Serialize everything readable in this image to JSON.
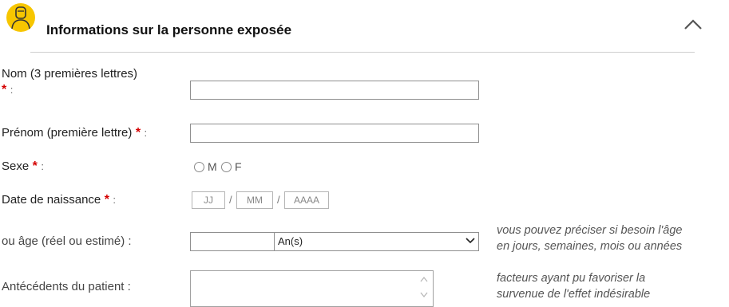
{
  "section": {
    "title": "Informations sur la personne exposée",
    "icon": "person-badge-icon",
    "accent_color": "#f7c600",
    "collapse_icon": "chevron-up-icon"
  },
  "fields": {
    "nom": {
      "label": "Nom (3 premières lettres)",
      "required_mark": "*",
      "colon": ":",
      "value": ""
    },
    "prenom": {
      "label": "Prénom (première lettre)",
      "required_mark": "*",
      "colon": ":",
      "value": ""
    },
    "sexe": {
      "label": "Sexe",
      "required_mark": "*",
      "colon": ":",
      "option_m": "M",
      "option_f": "F"
    },
    "date_naissance": {
      "label": "Date de naissance",
      "required_mark": "*",
      "colon": ":",
      "day_placeholder": "JJ",
      "month_placeholder": "MM",
      "year_placeholder": "AAAA",
      "separator": "/"
    },
    "age": {
      "label": "ou âge (réel ou estimé) :",
      "value": "",
      "unit_selected": "An(s)",
      "hint_line1": "vous pouvez préciser si besoin l'âge",
      "hint_line2": "en jours, semaines, mois ou années"
    },
    "antecedents": {
      "label": "Antécédents du patient :",
      "value": "",
      "hint_line1": "facteurs ayant pu favoriser la",
      "hint_line2": "survenue de l'effet indésirable"
    }
  },
  "colors": {
    "required": "#d40000",
    "divider": "#cfcfcf",
    "input_border": "#8f8f8f"
  }
}
